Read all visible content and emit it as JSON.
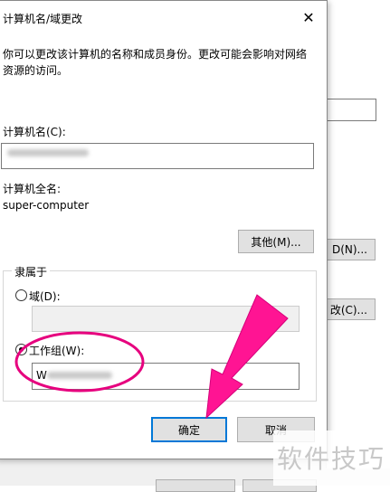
{
  "background_window": {
    "button1_label": "D(N)...",
    "button2_label": "改(C)..."
  },
  "dialog": {
    "title": "计算机名/域更改",
    "close_glyph": "✕",
    "description": "你可以更改该计算机的名称和成员身份。更改可能会影响对网络资源的访问。",
    "computer_name_label": "计算机名(C):",
    "full_name_label": "计算机全名:",
    "full_name_value": "super-computer",
    "more_button": "其他(M)...",
    "member_of_label": "隶属于",
    "domain_label": "域(D):",
    "workgroup_label": "工作组(W):",
    "workgroup_value_prefix": "W",
    "ok_button": "确定",
    "cancel_button": "取消"
  },
  "annotation": {
    "circle_color": "#e6007e",
    "arrow_color": "#ff1493"
  },
  "watermark": "软件技巧"
}
